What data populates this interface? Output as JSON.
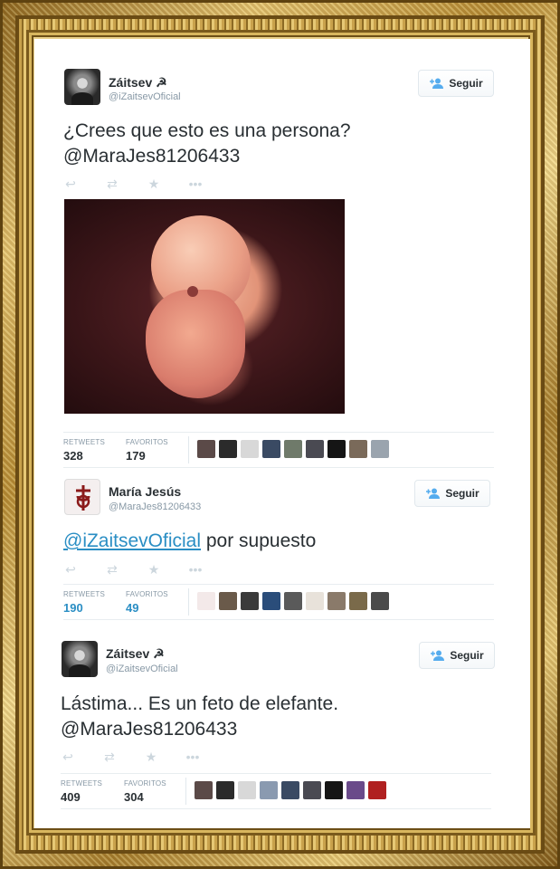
{
  "tweets": [
    {
      "name": "Záitsev ☭",
      "handle": "@iZaitsevOficial",
      "follow_label": "Seguir",
      "text_line1": "¿Crees que esto es una persona?",
      "text_line2": "@MaraJes81206433",
      "retweets_label": "RETWEETS",
      "retweets": "328",
      "favorites_label": "FAVORITOS",
      "favorites": "179"
    },
    {
      "name": "María Jesús",
      "handle": "@MaraJes81206433",
      "follow_label": "Seguir",
      "mention": "@iZaitsevOficial",
      "text_rest": " por supuesto",
      "retweets_label": "RETWEETS",
      "retweets": "190",
      "favorites_label": "FAVORITOS",
      "favorites": "49"
    },
    {
      "name": "Záitsev ☭",
      "handle": "@iZaitsevOficial",
      "follow_label": "Seguir",
      "text_line1": "Lástima... Es un feto de elefante.",
      "text_line2": "@MaraJes81206433",
      "retweets_label": "RETWEETS",
      "retweets": "409",
      "favorites_label": "FAVORITOS",
      "favorites": "304"
    }
  ],
  "icons": {
    "reply": "reply-icon",
    "retweet": "retweet-icon",
    "favorite": "star-icon",
    "more": "more-icon",
    "follow": "add-user-icon"
  },
  "colors": {
    "link": "#2a8ec4",
    "text": "#292f33",
    "muted": "#8899a6",
    "frame_gold": "#c9a24c"
  }
}
